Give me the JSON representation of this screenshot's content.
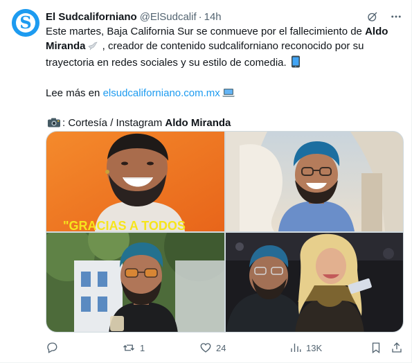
{
  "tweet": {
    "author_name": "El Sudcaliforniano",
    "handle": "@ElSudcalif",
    "separator": "·",
    "time": "14h",
    "avatar_letter": "S",
    "body": {
      "p1_a": "Este martes, Baja California Sur se conmueve por el fallecimiento de ",
      "p1_b": "Aldo Miranda",
      "p1_c": " , creador de contenido sudcaliforniano reconocido por su trayectoria en redes sociales y su estilo de comedia. ",
      "p2_a": "Lee más en ",
      "p2_link": "elsudcaliforniano.com.mx",
      "p3_a": ": Cortesía / Instagram ",
      "p3_b": "Aldo Miranda"
    },
    "media": {
      "overlay_text": "\"GRACIAS A TODOS"
    },
    "actions": {
      "replies": "",
      "retweets": "1",
      "likes": "24",
      "views": "13K"
    }
  },
  "icons": {
    "grok": "grok-icon",
    "more": "more-icon",
    "reply": "reply-icon",
    "retweet": "retweet-icon",
    "like": "heart-icon",
    "views": "views-icon",
    "bookmark": "bookmark-icon",
    "share": "share-icon"
  },
  "colors": {
    "brand": "#1d9bf0",
    "text": "#0f1419",
    "muted": "#536471",
    "orange_bg": "#f07a22",
    "overlay_yellow": "#f6e51d"
  }
}
